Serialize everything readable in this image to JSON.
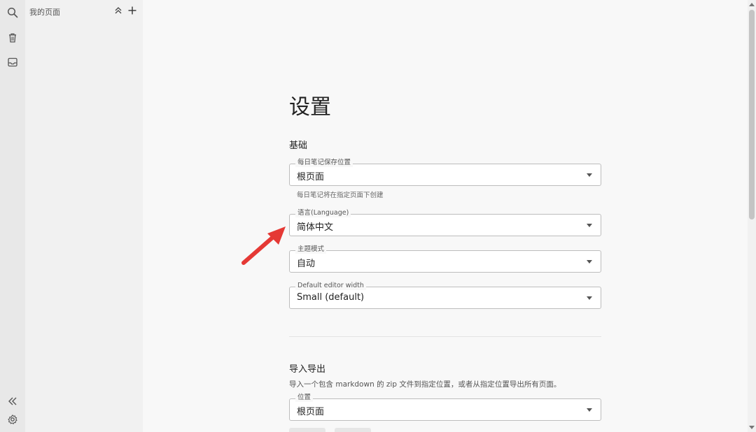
{
  "sidebar": {
    "title": "我的页面"
  },
  "rail": {
    "icons": [
      "search-icon",
      "trash-icon",
      "inbox-icon",
      "collapse-left-icon",
      "gear-icon"
    ]
  },
  "settings": {
    "title": "设置",
    "basic": {
      "heading": "基础",
      "daily_note": {
        "label": "每日笔记保存位置",
        "value": "根页面",
        "helper": "每日笔记将在指定页面下创建"
      },
      "language": {
        "label": "语言(Language)",
        "value": "简体中文"
      },
      "theme": {
        "label": "主题模式",
        "value": "自动"
      },
      "editor_width": {
        "label": "Default editor width",
        "value": "Small (default)"
      }
    },
    "import_export": {
      "heading": "导入导出",
      "description": "导入一个包含 markdown 的 zip 文件到指定位置，或者从指定位置导出所有页面。",
      "location": {
        "label": "位置",
        "value": "根页面"
      }
    }
  },
  "colors": {
    "annotation_arrow": "#e53935",
    "rail_bg": "#e8e8e8",
    "sidebar_bg": "#f1f1f1",
    "main_bg": "#f8f8f8"
  }
}
